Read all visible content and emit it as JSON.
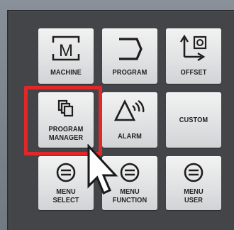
{
  "keypad": {
    "keys": [
      {
        "id": "machine",
        "icon": "machine-m-icon",
        "label": "MACHINE"
      },
      {
        "id": "program",
        "icon": "program-arrow-icon",
        "label": "PROGRAM"
      },
      {
        "id": "offset",
        "icon": "offset-axis-icon",
        "label": "OFFSET"
      },
      {
        "id": "program-manager",
        "icon": "program-manager-icon",
        "label": "PROGRAM\nMANAGER"
      },
      {
        "id": "alarm",
        "icon": "alarm-icon",
        "label": "ALARM"
      },
      {
        "id": "custom",
        "icon": "",
        "label": "CUSTOM"
      },
      {
        "id": "menu-select",
        "icon": "menu-key-icon",
        "label": "MENU\nSELECT"
      },
      {
        "id": "menu-function",
        "icon": "menu-key-icon",
        "label": "MENU\nFUNCTION"
      },
      {
        "id": "menu-user",
        "icon": "menu-key-icon",
        "label": "MENU\nUSER"
      }
    ],
    "highlighted_key": "program-manager"
  },
  "colors": {
    "panel": "#434548",
    "key_face": "#e1e2e3",
    "highlight": "#e12727",
    "background": "#7e8590"
  },
  "cursor": {
    "icon": "mouse-pointer-icon"
  }
}
